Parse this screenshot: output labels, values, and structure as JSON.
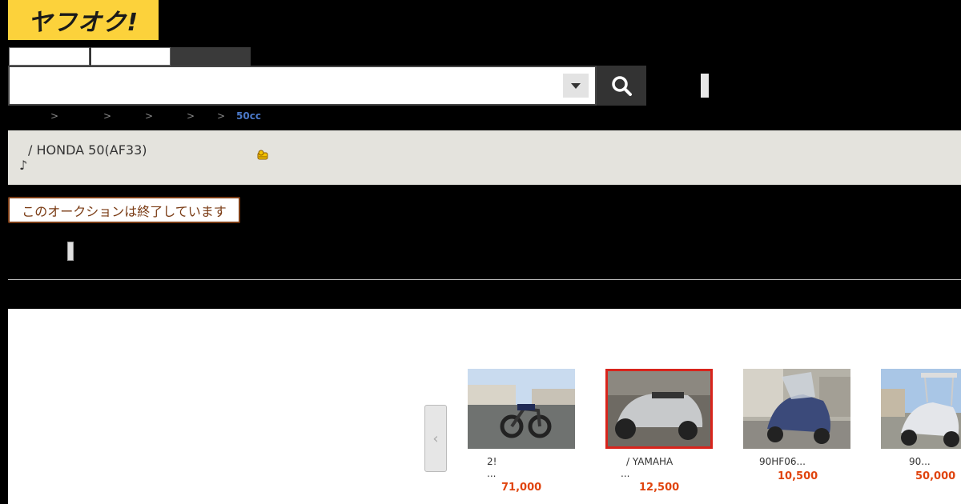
{
  "header": {
    "logo_text": "ヤフオク!",
    "logo_color": "#fcd23b"
  },
  "search": {
    "query": "",
    "placeholder": "",
    "button_icon": "search-icon",
    "dropdown_icon": "caret-down-icon"
  },
  "breadcrumb": {
    "separators": [
      ">",
      ">",
      ">",
      ">",
      ">"
    ],
    "current": "50cc"
  },
  "item": {
    "title": "/ HONDA 50(AF33)",
    "note": "♪"
  },
  "auction_status": {
    "ended_label": "このオークションは終了しています",
    "color": "#7a3b14"
  },
  "related": {
    "prev_icon": "chevron-left-icon",
    "items": [
      {
        "title": "2!",
        "more": "...",
        "price": "71,000"
      },
      {
        "title": "/ YAMAHA",
        "more": "...",
        "price": "12,500",
        "selected": true
      },
      {
        "title": "90HF06...",
        "more": "",
        "price": "10,500"
      },
      {
        "title": "90...",
        "more": "",
        "price": "50,000"
      }
    ],
    "price_color": "#e0440e",
    "highlight_color": "#d8241c"
  }
}
